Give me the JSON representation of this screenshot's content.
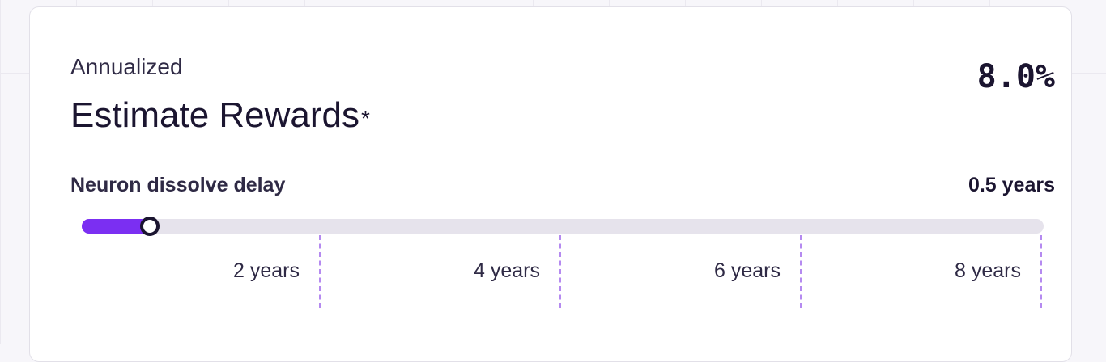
{
  "card": {
    "subtitle": "Annualized",
    "title": "Estimate Rewards",
    "title_asterisk": "*",
    "reward_rate": "8.0%"
  },
  "dissolve_delay": {
    "label": "Neuron dissolve delay",
    "value_text": "0.5 years",
    "value_years": 0.5,
    "max_years": 8,
    "ticks": [
      "2 years",
      "4 years",
      "6 years",
      "8 years"
    ]
  },
  "colors": {
    "accent": "#7b2ff2",
    "tick_line": "#b58af0",
    "text_dark": "#1b1530"
  }
}
